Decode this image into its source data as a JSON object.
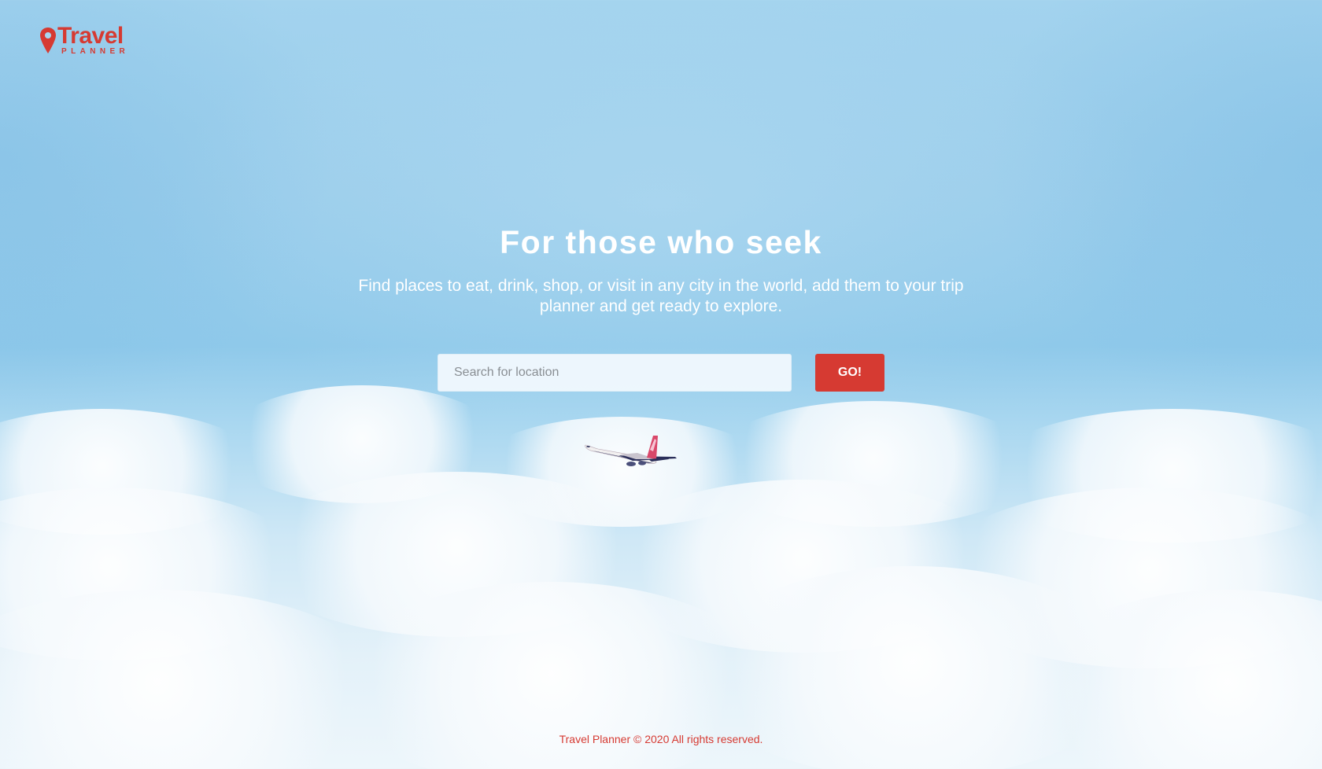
{
  "brand": {
    "title": "Travel",
    "subtitle": "PLANNER",
    "icon": "map-pin-icon",
    "color": "#d63a32"
  },
  "hero": {
    "title": "For those who seek",
    "description": "Find places to eat, drink, shop, or visit in any city in the world, add them to your trip planner and get ready to explore."
  },
  "search": {
    "placeholder": "Search for location",
    "value": "",
    "button_label": "GO!"
  },
  "footer": {
    "text": "Travel Planner © 2020 All rights reserved."
  },
  "colors": {
    "accent": "#d63a32",
    "sky": "#9acdeb",
    "text_on_sky": "#ffffff"
  }
}
